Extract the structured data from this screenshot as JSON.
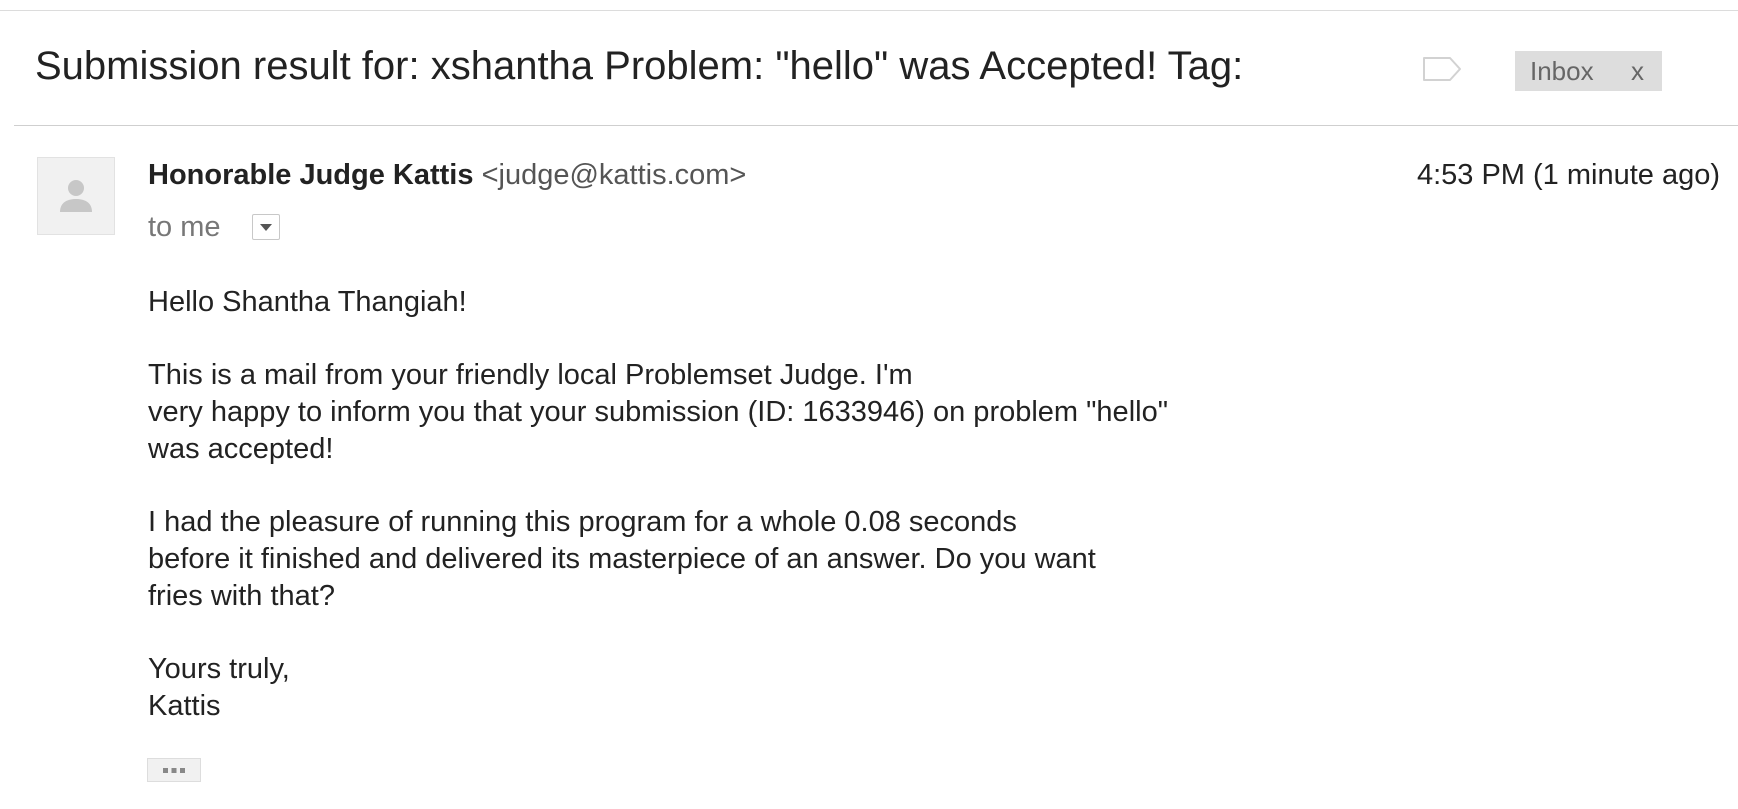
{
  "message": {
    "subject": "Submission result for: xshantha Problem: \"hello\" was Accepted! Tag:",
    "labels": [
      {
        "text": "Inbox",
        "remove": "x"
      }
    ],
    "sender": {
      "name": "Honorable Judge Kattis",
      "email": "<judge@kattis.com>"
    },
    "timestamp": "4:53 PM (1 minute ago)",
    "recipient": "to me",
    "body": [
      "Hello Shantha Thangiah!",
      "This is a mail from your friendly local Problemset Judge. I'm\nvery happy to inform you that your submission (ID: 1633946) on problem \"hello\"\nwas accepted!",
      "I had the pleasure of running this program for a whole 0.08 seconds\nbefore it finished and delivered its masterpiece of an answer. Do you want\nfries with that?",
      "Yours truly,\nKattis"
    ]
  },
  "icons": {
    "tag": "label-tag-icon",
    "avatar": "person-icon",
    "details": "caret-down-icon",
    "trimmed": "ellipsis-icon"
  },
  "colors": {
    "label_chip_bg": "#dddddd",
    "label_chip_text": "#666666",
    "text": "#222222",
    "muted": "#777777"
  }
}
